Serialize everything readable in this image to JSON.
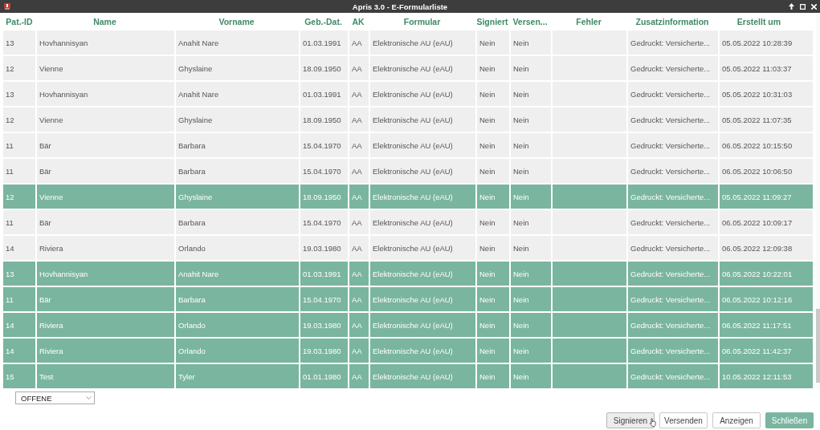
{
  "window": {
    "title": "Apris 3.0 - E-Formularliste"
  },
  "table": {
    "columns": [
      "Pat.-ID",
      "Name",
      "Vorname",
      "Geb.-Dat.",
      "AK",
      "Formular",
      "Signiert",
      "Versen...",
      "Fehler",
      "Zusatzinformation",
      "Erstellt um"
    ],
    "rows": [
      {
        "selected": false,
        "cells": [
          "13",
          "Hovhannisyan",
          "Anahit Nare",
          "01.03.1991",
          "AA",
          "Elektronische AU (eAU)",
          "Nein",
          "Nein",
          null,
          "Gedruckt: Versicherte...",
          "05.05.2022 10:28:39"
        ]
      },
      {
        "selected": false,
        "cells": [
          "12",
          "Vienne",
          "Ghyslaine",
          "18.09.1950",
          "AA",
          "Elektronische AU (eAU)",
          "Nein",
          "Nein",
          null,
          "Gedruckt: Versicherte...",
          "05.05.2022 11:03:37"
        ]
      },
      {
        "selected": false,
        "cells": [
          "13",
          "Hovhannisyan",
          "Anahit Nare",
          "01.03.1991",
          "AA",
          "Elektronische AU (eAU)",
          "Nein",
          "Nein",
          null,
          "Gedruckt: Versicherte...",
          "05.05.2022 10:31:03"
        ]
      },
      {
        "selected": false,
        "cells": [
          "12",
          "Vienne",
          "Ghyslaine",
          "18.09.1950",
          "AA",
          "Elektronische AU (eAU)",
          "Nein",
          "Nein",
          null,
          "Gedruckt: Versicherte...",
          "05.05.2022 11:07:35"
        ]
      },
      {
        "selected": false,
        "cells": [
          "11",
          "Bär",
          "Barbara",
          "15.04.1970",
          "AA",
          "Elektronische AU (eAU)",
          "Nein",
          "Nein",
          null,
          "Gedruckt: Versicherte...",
          "06.05.2022 10:15:50"
        ]
      },
      {
        "selected": false,
        "cells": [
          "11",
          "Bär",
          "Barbara",
          "15.04.1970",
          "AA",
          "Elektronische AU (eAU)",
          "Nein",
          "Nein",
          null,
          "Gedruckt: Versicherte...",
          "06.05.2022 10:06:50"
        ]
      },
      {
        "selected": true,
        "cells": [
          "12",
          "Vienne",
          "Ghyslaine",
          "18.09.1950",
          "AA",
          "Elektronische AU (eAU)",
          "Nein",
          "Nein",
          null,
          "Gedruckt: Versicherte...",
          "05.05.2022 11:09:27"
        ]
      },
      {
        "selected": false,
        "cells": [
          "11",
          "Bär",
          "Barbara",
          "15.04.1970",
          "AA",
          "Elektronische AU (eAU)",
          "Nein",
          "Nein",
          null,
          "Gedruckt: Versicherte...",
          "06.05.2022 10:09:17"
        ]
      },
      {
        "selected": false,
        "cells": [
          "14",
          "Riviera",
          "Orlando",
          "19.03.1980",
          "AA",
          "Elektronische AU (eAU)",
          "Nein",
          "Nein",
          null,
          "Gedruckt: Versicherte...",
          "06.05.2022 12:09:38"
        ]
      },
      {
        "selected": true,
        "cells": [
          "13",
          "Hovhannisyan",
          "Anahit Nare",
          "01.03.1991",
          "AA",
          "Elektronische AU (eAU)",
          "Nein",
          "Nein",
          null,
          "Gedruckt: Versicherte...",
          "06.05.2022 10:22:01"
        ]
      },
      {
        "selected": true,
        "cells": [
          "11",
          "Bär",
          "Barbara",
          "15.04.1970",
          "AA",
          "Elektronische AU (eAU)",
          "Nein",
          "Nein",
          null,
          "Gedruckt: Versicherte...",
          "06.05.2022 10:12:16"
        ]
      },
      {
        "selected": true,
        "cells": [
          "14",
          "Riviera",
          "Orlando",
          "19.03.1980",
          "AA",
          "Elektronische AU (eAU)",
          "Nein",
          "Nein",
          null,
          "Gedruckt: Versicherte...",
          "06.05.2022 11:17:51"
        ]
      },
      {
        "selected": true,
        "cells": [
          "14",
          "Riviera",
          "Orlando",
          "19.03.1980",
          "AA",
          "Elektronische AU (eAU)",
          "Nein",
          "Nein",
          null,
          "Gedruckt: Versicherte...",
          "06.05.2022 11:42:37"
        ]
      },
      {
        "selected": true,
        "cells": [
          "15",
          "Test",
          "Tyler",
          "01.01.1980",
          "AA",
          "Elektronische AU (eAU)",
          "Nein",
          "Nein",
          null,
          "Gedruckt: Versicherte...",
          "10.05.2022 12:11:53"
        ]
      }
    ]
  },
  "filter": {
    "value": "OFFENE"
  },
  "buttons": [
    {
      "label": "Signieren",
      "kind": "default",
      "hovered": true
    },
    {
      "label": "Versenden",
      "kind": "default",
      "hovered": false
    },
    {
      "label": "Anzeigen",
      "kind": "default",
      "hovered": false
    },
    {
      "label": "Schließen",
      "kind": "primary",
      "hovered": false
    }
  ]
}
